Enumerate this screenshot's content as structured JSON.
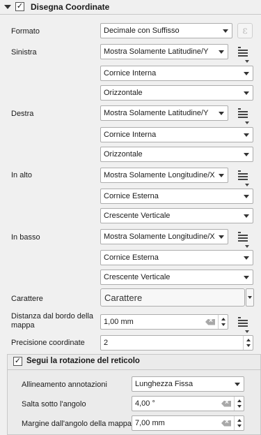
{
  "section": {
    "title": "Disegna Coordinate",
    "checked": true
  },
  "format": {
    "label": "Formato",
    "value": "Decimale con Suffisso",
    "expr_icon": "epsilon-icon"
  },
  "left": {
    "label": "Sinistra",
    "show": "Mostra Solamente Latitudine/Y",
    "position": "Cornice Interna",
    "direction": "Orizzontale"
  },
  "right": {
    "label": "Destra",
    "show": "Mostra Solamente Latitudine/Y",
    "position": "Cornice Interna",
    "direction": "Orizzontale"
  },
  "top": {
    "label": "In alto",
    "show": "Mostra Solamente Longitudine/X",
    "position": "Cornice Esterna",
    "direction": "Crescente Verticale"
  },
  "bottom": {
    "label": "In basso",
    "show": "Mostra Solamente Longitudine/X",
    "position": "Cornice Esterna",
    "direction": "Crescente Verticale"
  },
  "font": {
    "label": "Carattere",
    "button": "Carattere"
  },
  "distance": {
    "label_line1": "Distanza dal bordo della",
    "label_line2": "mappa",
    "value": "1,00 mm"
  },
  "precision": {
    "label": "Precisione coordinate",
    "value": "2"
  },
  "follow_rotation": {
    "label": "Segui la rotazione del reticolo",
    "checked": true,
    "alignment_label": "Allineamento annotazioni",
    "alignment_value": "Lunghezza Fissa",
    "skip_label": "Salta sotto l'angolo",
    "skip_value": "4,00 °",
    "margin_label": "Margine dall'angolo della mappa",
    "margin_value": "7,00 mm"
  }
}
